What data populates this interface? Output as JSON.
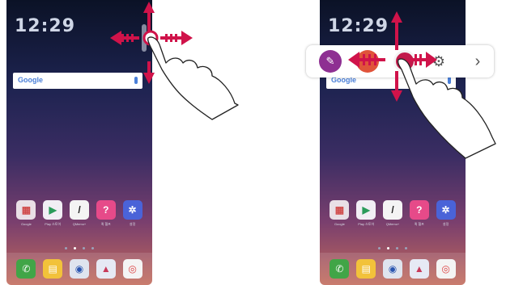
{
  "screens": [
    {
      "clock": "12:29",
      "search_brand": "Google",
      "apps": [
        {
          "icon": "folder-icon",
          "color": "#e9dfe6",
          "label": "Google"
        },
        {
          "icon": "play-store-icon",
          "color": "#f1eef4",
          "label": "Play 스토어"
        },
        {
          "icon": "qmemo-icon",
          "color": "#f4f4f4",
          "label": "QMemo+"
        },
        {
          "icon": "help-icon",
          "color": "#e64a89",
          "label": "퀵 헬프"
        },
        {
          "icon": "settings-icon",
          "color": "#4a63d8",
          "label": "설정"
        }
      ],
      "dock": [
        {
          "icon": "phone-icon",
          "color": "#41a547"
        },
        {
          "icon": "messages-icon",
          "color": "#f2c23a"
        },
        {
          "icon": "camera-icon",
          "color": "#dfe4ee"
        },
        {
          "icon": "gallery-icon",
          "color": "#e6e9f4"
        },
        {
          "icon": "chrome-icon",
          "color": "#f4f4f4"
        }
      ]
    },
    {
      "clock": "12:29",
      "search_brand": "Google",
      "apps": [
        {
          "icon": "folder-icon",
          "color": "#e9dfe6",
          "label": "Google"
        },
        {
          "icon": "play-store-icon",
          "color": "#f1eef4",
          "label": "Play 스토어"
        },
        {
          "icon": "qmemo-icon",
          "color": "#f4f4f4",
          "label": "QMemo+"
        },
        {
          "icon": "help-icon",
          "color": "#e64a89",
          "label": "퀵 헬프"
        },
        {
          "icon": "settings-icon",
          "color": "#4a63d8",
          "label": "설정"
        }
      ],
      "dock": [
        {
          "icon": "phone-icon",
          "color": "#41a547"
        },
        {
          "icon": "messages-icon",
          "color": "#f2c23a"
        },
        {
          "icon": "camera-icon",
          "color": "#dfe4ee"
        },
        {
          "icon": "gallery-icon",
          "color": "#e6e9f4"
        },
        {
          "icon": "chrome-icon",
          "color": "#f4f4f4"
        }
      ]
    }
  ],
  "floating_bar": {
    "items": [
      {
        "icon": "qmemo-edit-icon",
        "color": "#8e2f92"
      },
      {
        "icon": "recent-app-icon",
        "color": "#e0533a"
      },
      {
        "icon": "record-icon",
        "color": "#c2194a"
      },
      {
        "icon": "camera-icon",
        "color": "#3a9bd1"
      },
      {
        "icon": "settings-gear-icon",
        "color": "#555555"
      },
      {
        "icon": "chevron-right-icon",
        "color": "#555555"
      }
    ]
  },
  "colors": {
    "arrow": "#d0134a",
    "hand_outline": "#222222"
  }
}
